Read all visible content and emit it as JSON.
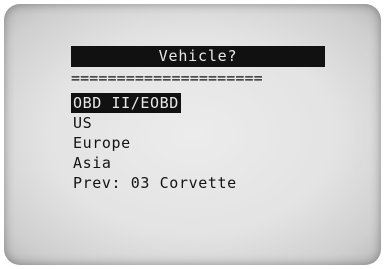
{
  "screen": {
    "title": "Vehicle?",
    "divider": "====================="
  },
  "menu": {
    "items": [
      {
        "label": "OBD II/EOBD",
        "selected": true
      },
      {
        "label": "US",
        "selected": false
      },
      {
        "label": "Europe",
        "selected": false
      },
      {
        "label": "Asia",
        "selected": false
      },
      {
        "label": "Prev: 03 Corvette",
        "selected": false
      }
    ]
  },
  "colors": {
    "lcd_background": "#e3e3e3",
    "lcd_text": "#141414",
    "highlight_background": "#111111",
    "highlight_text": "#e8e8e8"
  }
}
